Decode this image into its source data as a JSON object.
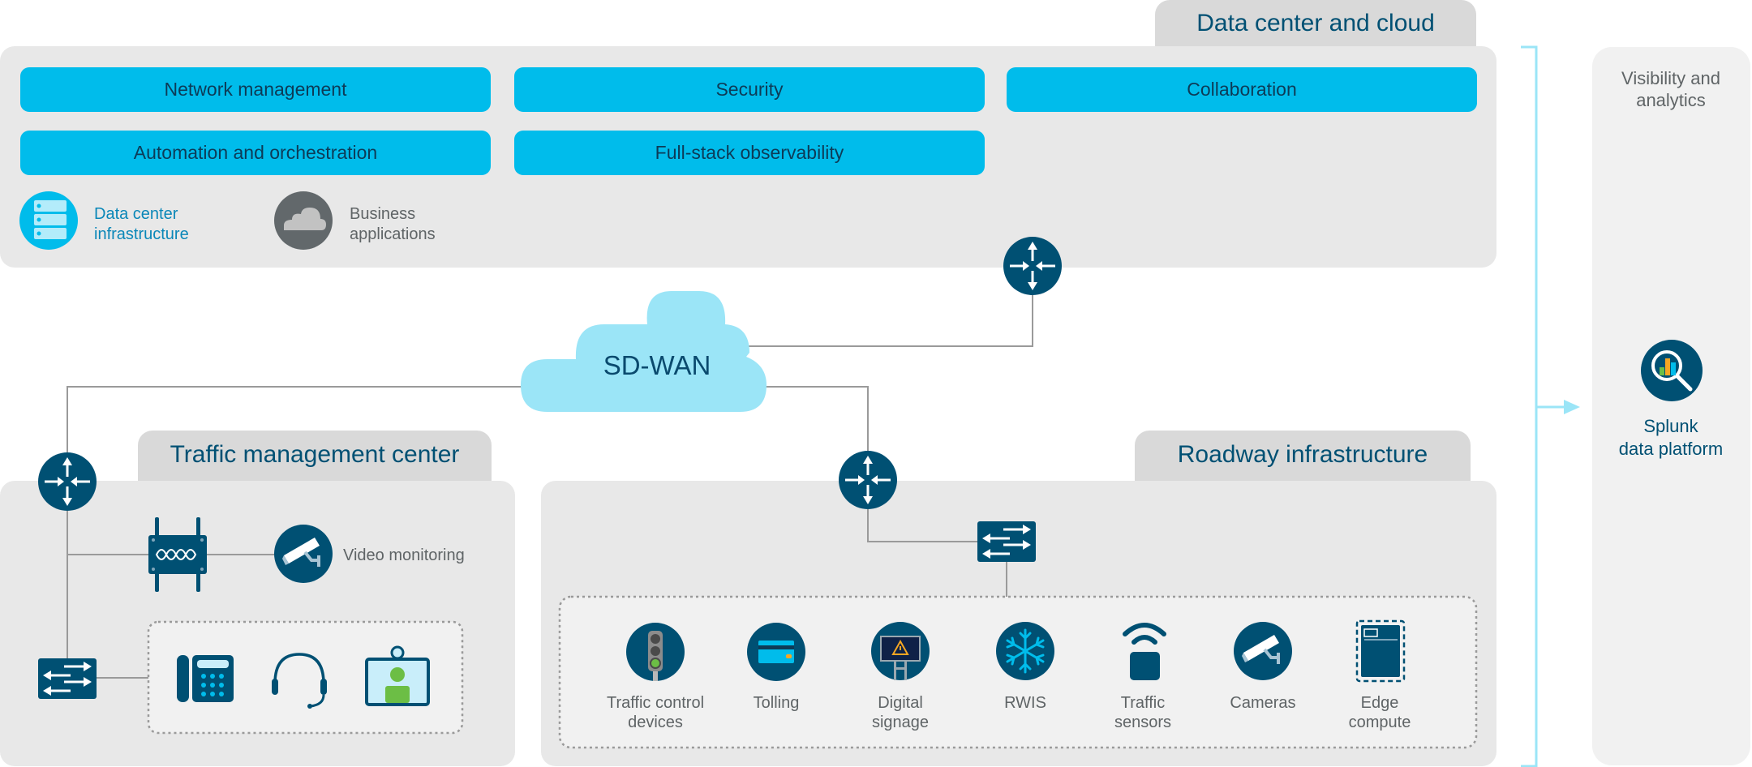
{
  "colors": {
    "accent": "#00bceb",
    "dark_blue": "#005073",
    "panel_gray": "#e8e8e8",
    "tab_gray": "#d9d9d9",
    "cloud_blue": "#9be5f7",
    "line_gray": "#9a9a9a"
  },
  "data_center": {
    "title": "Data center and cloud",
    "buttons": [
      {
        "label": "Network management"
      },
      {
        "label": "Security"
      },
      {
        "label": "Collaboration"
      },
      {
        "label": "Automation and orchestration"
      },
      {
        "label": "Full-stack observability"
      }
    ],
    "legend": [
      {
        "icon": "server-stack-icon",
        "line1": "Data center",
        "line2": "infrastructure"
      },
      {
        "icon": "cloud-icon",
        "line1": "Business",
        "line2": "applications"
      }
    ]
  },
  "wan": {
    "label": "SD-WAN"
  },
  "traffic_center": {
    "title": "Traffic management center",
    "video_label": "Video monitoring",
    "endpoints": [
      "ip-phone-icon",
      "headset-icon",
      "video-endpoint-icon"
    ]
  },
  "roadway": {
    "title": "Roadway infrastructure",
    "devices": [
      {
        "icon": "traffic-light-icon",
        "line1": "Traffic control",
        "line2": "devices"
      },
      {
        "icon": "credit-card-icon",
        "line1": "Tolling",
        "line2": ""
      },
      {
        "icon": "digital-sign-icon",
        "line1": "Digital",
        "line2": "signage"
      },
      {
        "icon": "snowflake-icon",
        "line1": "RWIS",
        "line2": ""
      },
      {
        "icon": "sensor-icon",
        "line1": "Traffic",
        "line2": "sensors"
      },
      {
        "icon": "camera-icon",
        "line1": "Cameras",
        "line2": ""
      },
      {
        "icon": "edge-compute-icon",
        "line1": "Edge",
        "line2": "compute"
      }
    ]
  },
  "analytics": {
    "title_line1": "Visibility and",
    "title_line2": "analytics",
    "platform_line1": "Splunk",
    "platform_line2": "data platform"
  }
}
